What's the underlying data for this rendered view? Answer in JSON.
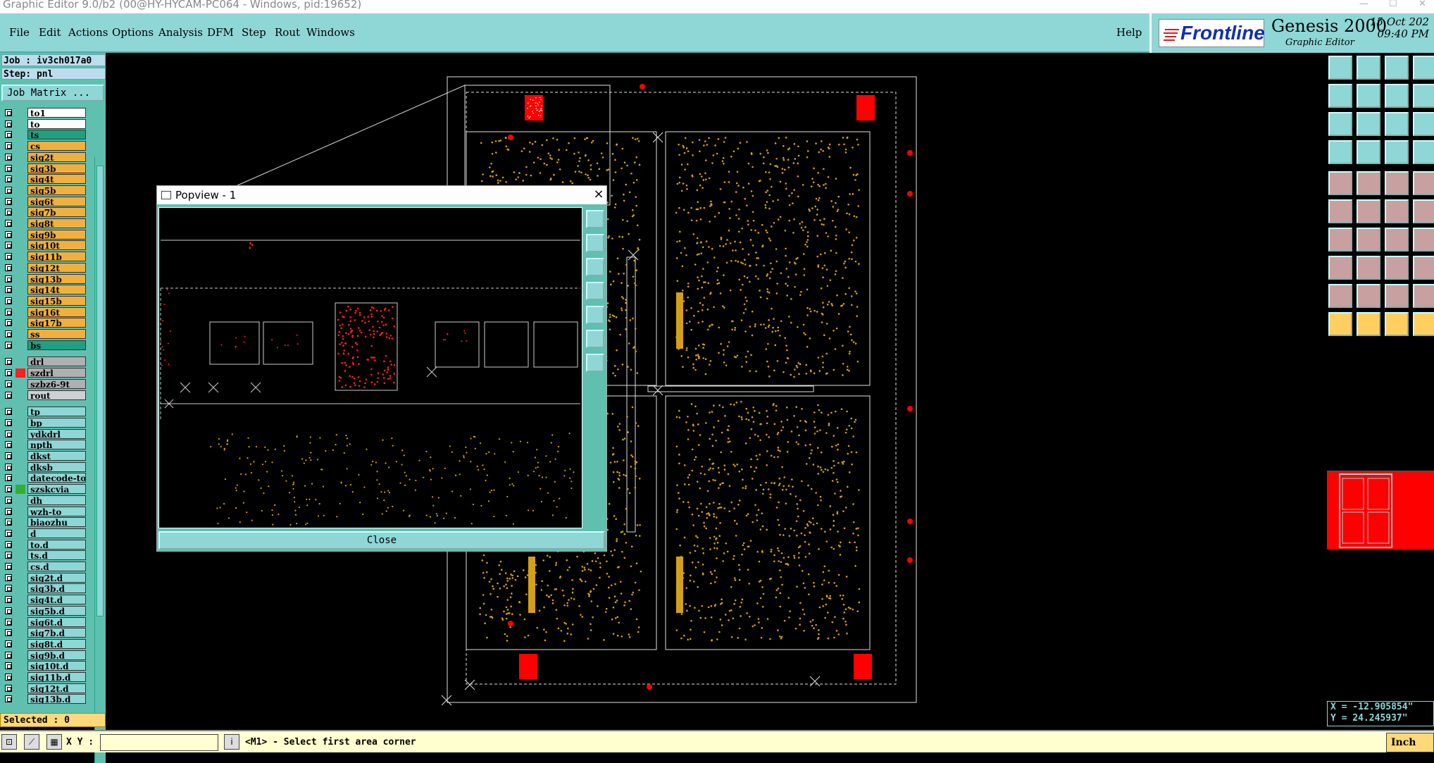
{
  "window": {
    "title": "Graphic Editor 9.0/b2 (00@HY-HYCAM-PC064 - Windows, pid:19652)"
  },
  "menu": [
    "File",
    "Edit",
    "Actions",
    "Options",
    "Analysis",
    "DFM",
    "Step",
    "Rout",
    "Windows"
  ],
  "help": "Help",
  "brand": {
    "logo": "Frontline",
    "product": "Genesis 2000",
    "subtitle": "Graphic Editor",
    "date": "15 Oct 202",
    "time": "09:40 PM"
  },
  "job": {
    "job_label": "Job : iv3ch017a0",
    "step_label": "Step: pnl",
    "matrix_button": "Job Matrix ..."
  },
  "layers": [
    {
      "name": "to1",
      "color": "#ffffff",
      "swatch": ""
    },
    {
      "name": "to",
      "color": "#ffffff",
      "swatch": ""
    },
    {
      "name": "ts",
      "color": "#20a080",
      "swatch": ""
    },
    {
      "name": "cs",
      "color": "#f0b040",
      "swatch": ""
    },
    {
      "name": "sig2t",
      "color": "#f0b040",
      "swatch": ""
    },
    {
      "name": "sig3b",
      "color": "#f0b040",
      "swatch": ""
    },
    {
      "name": "sig4t",
      "color": "#f0b040",
      "swatch": ""
    },
    {
      "name": "sig5b",
      "color": "#f0b040",
      "swatch": ""
    },
    {
      "name": "sig6t",
      "color": "#f0b040",
      "swatch": ""
    },
    {
      "name": "sig7b",
      "color": "#f0b040",
      "swatch": ""
    },
    {
      "name": "sig8t",
      "color": "#f0b040",
      "swatch": ""
    },
    {
      "name": "sig9b",
      "color": "#f0b040",
      "swatch": ""
    },
    {
      "name": "sig10t",
      "color": "#f0b040",
      "swatch": ""
    },
    {
      "name": "sig11b",
      "color": "#f0b040",
      "swatch": ""
    },
    {
      "name": "sig12t",
      "color": "#f0b040",
      "swatch": ""
    },
    {
      "name": "sig13b",
      "color": "#f0b040",
      "swatch": ""
    },
    {
      "name": "sig14t",
      "color": "#f0b040",
      "swatch": ""
    },
    {
      "name": "sig15b",
      "color": "#f0b040",
      "swatch": ""
    },
    {
      "name": "sig16t",
      "color": "#f0b040",
      "swatch": ""
    },
    {
      "name": "sig17b",
      "color": "#f0b040",
      "swatch": ""
    },
    {
      "name": "ss",
      "color": "#f0b040",
      "swatch": ""
    },
    {
      "name": "bs",
      "color": "#20a080",
      "swatch": ""
    },
    {
      "name": "drl",
      "color": "#b0b0b0",
      "swatch": ""
    },
    {
      "name": "szdrl",
      "color": "#b0b0b0",
      "swatch": "#ff2020"
    },
    {
      "name": "szbz6-9t",
      "color": "#b0b0b0",
      "swatch": ""
    },
    {
      "name": "rout",
      "color": "#d0d0d0",
      "swatch": ""
    },
    {
      "name": "tp",
      "color": "#8fd6d6",
      "swatch": ""
    },
    {
      "name": "bp",
      "color": "#8fd6d6",
      "swatch": ""
    },
    {
      "name": "ydkdrl",
      "color": "#8fd6d6",
      "swatch": ""
    },
    {
      "name": "npth",
      "color": "#8fd6d6",
      "swatch": ""
    },
    {
      "name": "dkst",
      "color": "#8fd6d6",
      "swatch": ""
    },
    {
      "name": "dksb",
      "color": "#8fd6d6",
      "swatch": ""
    },
    {
      "name": "datecode-to",
      "color": "#8fd6d6",
      "swatch": ""
    },
    {
      "name": "szskcvia",
      "color": "#8fd6d6",
      "swatch": "#30b030"
    },
    {
      "name": "dh",
      "color": "#8fd6d6",
      "swatch": ""
    },
    {
      "name": "wzh-to",
      "color": "#8fd6d6",
      "swatch": ""
    },
    {
      "name": "biaozhu",
      "color": "#8fd6d6",
      "swatch": ""
    },
    {
      "name": "d",
      "color": "#8fd6d6",
      "swatch": ""
    },
    {
      "name": "to.d",
      "color": "#8fd6d6",
      "swatch": ""
    },
    {
      "name": "ts.d",
      "color": "#8fd6d6",
      "swatch": ""
    },
    {
      "name": "cs.d",
      "color": "#8fd6d6",
      "swatch": ""
    },
    {
      "name": "sig2t.d",
      "color": "#8fd6d6",
      "swatch": ""
    },
    {
      "name": "sig3b.d",
      "color": "#8fd6d6",
      "swatch": ""
    },
    {
      "name": "sig4t.d",
      "color": "#8fd6d6",
      "swatch": ""
    },
    {
      "name": "sig5b.d",
      "color": "#8fd6d6",
      "swatch": ""
    },
    {
      "name": "sig6t.d",
      "color": "#8fd6d6",
      "swatch": ""
    },
    {
      "name": "sig7b.d",
      "color": "#8fd6d6",
      "swatch": ""
    },
    {
      "name": "sig8t.d",
      "color": "#8fd6d6",
      "swatch": ""
    },
    {
      "name": "sig9b.d",
      "color": "#8fd6d6",
      "swatch": ""
    },
    {
      "name": "sig10t.d",
      "color": "#8fd6d6",
      "swatch": ""
    },
    {
      "name": "sig11b.d",
      "color": "#8fd6d6",
      "swatch": ""
    },
    {
      "name": "sig12t.d",
      "color": "#8fd6d6",
      "swatch": ""
    },
    {
      "name": "sig13b.d",
      "color": "#8fd6d6",
      "swatch": ""
    }
  ],
  "selected": "Selected : 0",
  "popview": {
    "title": "Popview - 1",
    "close_x": "×",
    "close_button": "Close"
  },
  "status": {
    "xy_label": "X Y :",
    "xy_value": "",
    "message": "<M1> - Select first area corner",
    "units": "Inch"
  },
  "coords": {
    "x": "X = -12.905854\"",
    "y": "Y = 24.245937\""
  },
  "colors": {
    "panel": "#8fd6d6",
    "accent": "#5fc0b0",
    "copper": "#d4a017",
    "marker": "#ff0000"
  }
}
